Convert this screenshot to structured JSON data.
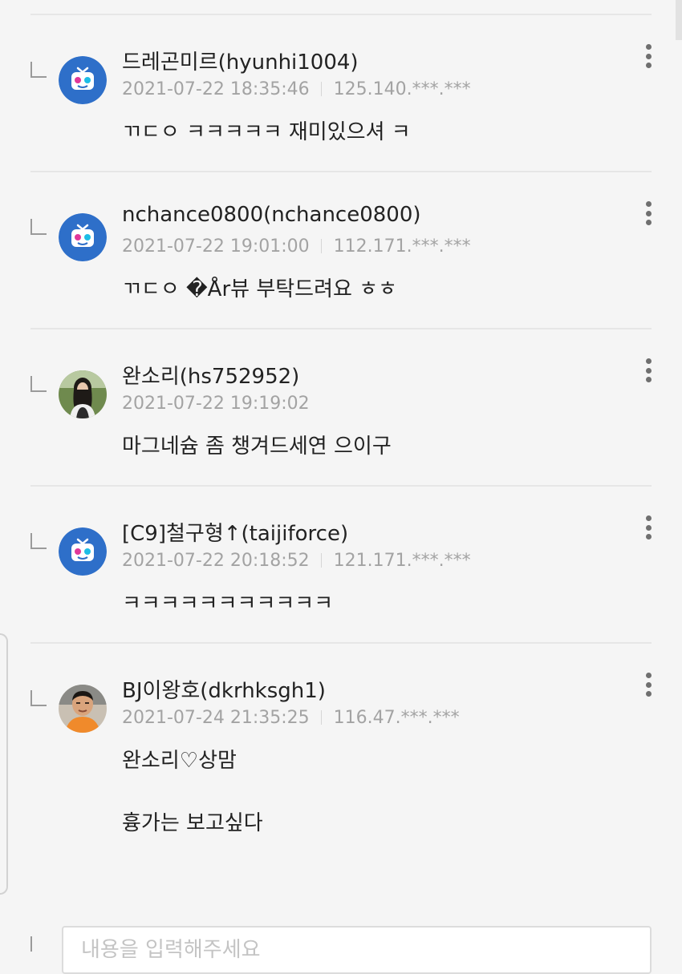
{
  "comments": [
    {
      "nickname": "드레곤미르(hyunhi1004)",
      "datetime": "2021-07-22 18:35:46",
      "ip": "125.140.***.***",
      "lines": [
        "ㄲㄷㅇ ㅋㅋㅋㅋㅋ 재미있으셔 ㅋ"
      ],
      "avatar_icon": "default-tv-avatar-icon"
    },
    {
      "nickname": "nchance0800(nchance0800)",
      "datetime": "2021-07-22 19:01:00",
      "ip": "112.171.***.***",
      "lines": [
        "ㄲㄷㅇ �År뷰 부탁드려요 ㅎㅎ"
      ],
      "avatar_icon": "default-tv-avatar-icon"
    },
    {
      "nickname": "완소리(hs752952)",
      "datetime": "2021-07-22 19:19:02",
      "ip": "",
      "lines": [
        "마그네슘 좀 챙겨드세연 으이구"
      ],
      "avatar_icon": "profile-photo-woman"
    },
    {
      "nickname": "[C9]철구형↑(taijiforce)",
      "datetime": "2021-07-22 20:18:52",
      "ip": "121.171.***.***",
      "lines": [
        "ㅋㅋㅋㅋㅋㅋㅋㅋㅋㅋㅋ"
      ],
      "avatar_icon": "default-tv-avatar-icon"
    },
    {
      "nickname": "BJ이왕호(dkrhksgh1)",
      "datetime": "2021-07-24 21:35:25",
      "ip": "116.47.***.***",
      "lines": [
        "완소리♡상맘",
        "흉가는 보고싶다"
      ],
      "avatar_icon": "profile-photo-man"
    }
  ],
  "reply_input": {
    "placeholder": "내용을 입력해주세요"
  },
  "colors": {
    "background": "#f5f5f5",
    "text": "#222222",
    "meta_text": "#a3a3a3",
    "avatar_blue": "#2e6fc9"
  }
}
